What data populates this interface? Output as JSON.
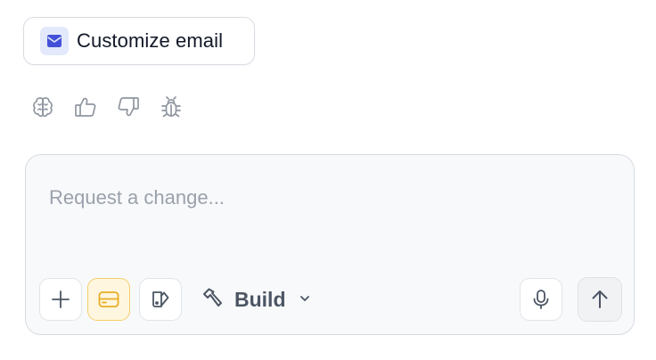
{
  "chip": {
    "label": "Customize email",
    "icon": "mail-icon",
    "icon_bg": "#e3e9fb",
    "icon_color": "#4351d8"
  },
  "feedback": {
    "icons": [
      "brain-icon",
      "thumbs-up-icon",
      "thumbs-down-icon",
      "bug-icon"
    ]
  },
  "composer": {
    "placeholder": "Request a change...",
    "mode_label": "Build",
    "mode_icon": "hammer-icon",
    "accent_border": "#f5cf6a",
    "accent_bg": "#fff6df"
  }
}
